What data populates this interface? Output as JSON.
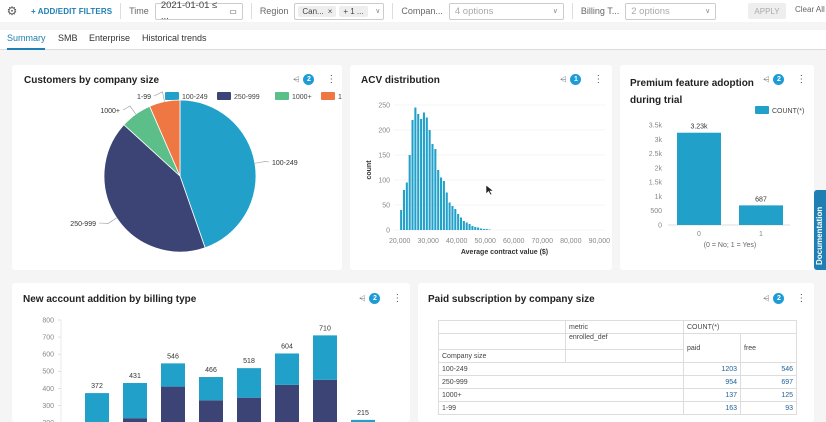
{
  "filter_bar": {
    "add_filters_label": "+ ADD/EDIT FILTERS",
    "time_label": "Time",
    "time_value": "2021-01-01 ≤ ...",
    "region_label": "Region",
    "region_chip": "Can...",
    "region_more_chip": "+ 1 ...",
    "company_label": "Compan...",
    "company_placeholder": "4 options",
    "billing_label": "Billing T...",
    "billing_placeholder": "2 options",
    "apply_label": "APPLY",
    "clear_label": "Clear All"
  },
  "tabs": [
    "Summary",
    "SMB",
    "Enterprise",
    "Historical trends"
  ],
  "documentation_label": "Documentation",
  "cards": {
    "customers": {
      "title": "Customers by company size",
      "filter_count": "2"
    },
    "acv": {
      "title": "ACV distribution",
      "filter_count": "1"
    },
    "premium": {
      "title_line1": "Premium feature adoption",
      "title_line2": "during trial",
      "filter_count": "2"
    },
    "new_accounts": {
      "title": "New account addition by billing type",
      "filter_count": "2"
    },
    "paid_sub": {
      "title": "Paid subscription by company size",
      "filter_count": "2"
    }
  },
  "colors": {
    "accent": "#1d7fb3",
    "teal": "#21a0c9",
    "navy": "#3b4475",
    "green": "#5cbf8a",
    "orange": "#ee7744"
  },
  "chart_data": [
    {
      "type": "pie",
      "title": "Customers by company size",
      "legend": [
        "100-249",
        "250-999",
        "1000+",
        "1-99"
      ],
      "legend_placement": "top",
      "slices": [
        {
          "label": "100-249",
          "value": 1749,
          "color": "#21a0c9"
        },
        {
          "label": "250-999",
          "value": 1651,
          "color": "#3b4475"
        },
        {
          "label": "1000+",
          "value": 262,
          "color": "#5cbf8a"
        },
        {
          "label": "1-99",
          "value": 256,
          "color": "#ee7744"
        }
      ]
    },
    {
      "type": "bar",
      "title": "ACV distribution",
      "xlabel": "Average contract value ($)",
      "ylabel": "count",
      "ylim": [
        0,
        250
      ],
      "yticks": [
        0,
        50,
        100,
        150,
        200,
        250
      ],
      "xticks": [
        "20,000",
        "30,000",
        "40,000",
        "50,000",
        "60,000",
        "70,000",
        "80,000",
        "90,000"
      ],
      "xlim": [
        18000,
        92000
      ],
      "bin_start": 20000,
      "bin_width": 1000,
      "values": [
        40,
        80,
        95,
        150,
        220,
        245,
        232,
        222,
        235,
        225,
        200,
        172,
        162,
        120,
        105,
        98,
        75,
        55,
        48,
        42,
        32,
        25,
        18,
        15,
        12,
        8,
        6,
        5,
        3,
        2,
        2,
        1
      ]
    },
    {
      "type": "bar",
      "title": "Premium feature adoption during trial",
      "xlabel": "(0 = No; 1 = Yes)",
      "legend": [
        "COUNT(*)"
      ],
      "legend_placement": "top-right",
      "categories": [
        "0",
        "1"
      ],
      "values": [
        3230,
        687
      ],
      "data_labels": [
        "3.23k",
        "687"
      ],
      "ylim": [
        0,
        3500
      ],
      "yticks": [
        "0",
        "500",
        "1k",
        "1.5k",
        "2k",
        "2.5k",
        "3k",
        "3.5k"
      ]
    },
    {
      "type": "bar",
      "stacked": true,
      "title": "New account addition by billing type",
      "ylim": [
        150,
        800
      ],
      "yticks": [
        200,
        300,
        400,
        500,
        600,
        700,
        800
      ],
      "totals": [
        372,
        431,
        546,
        466,
        518,
        604,
        710,
        215
      ],
      "series": [
        {
          "color": "#3b4475",
          "values": [
            0,
            225,
            410,
            330,
            345,
            420,
            450,
            0
          ]
        },
        {
          "color": "#21a0c9",
          "values": [
            372,
            206,
            136,
            136,
            173,
            184,
            260,
            215
          ]
        }
      ]
    },
    {
      "type": "table",
      "title": "Paid subscription by company size",
      "header_metric": "metric",
      "header_count": "COUNT(*)",
      "header_enrolled": "enrolled_def",
      "row_header": "Company size",
      "col_paid": "paid",
      "col_free": "free",
      "rows": [
        {
          "size": "100-249",
          "paid": "1203",
          "free": "546"
        },
        {
          "size": "250-999",
          "paid": "954",
          "free": "697"
        },
        {
          "size": "1000+",
          "paid": "137",
          "free": "125"
        },
        {
          "size": "1-99",
          "paid": "163",
          "free": "93"
        }
      ]
    }
  ]
}
